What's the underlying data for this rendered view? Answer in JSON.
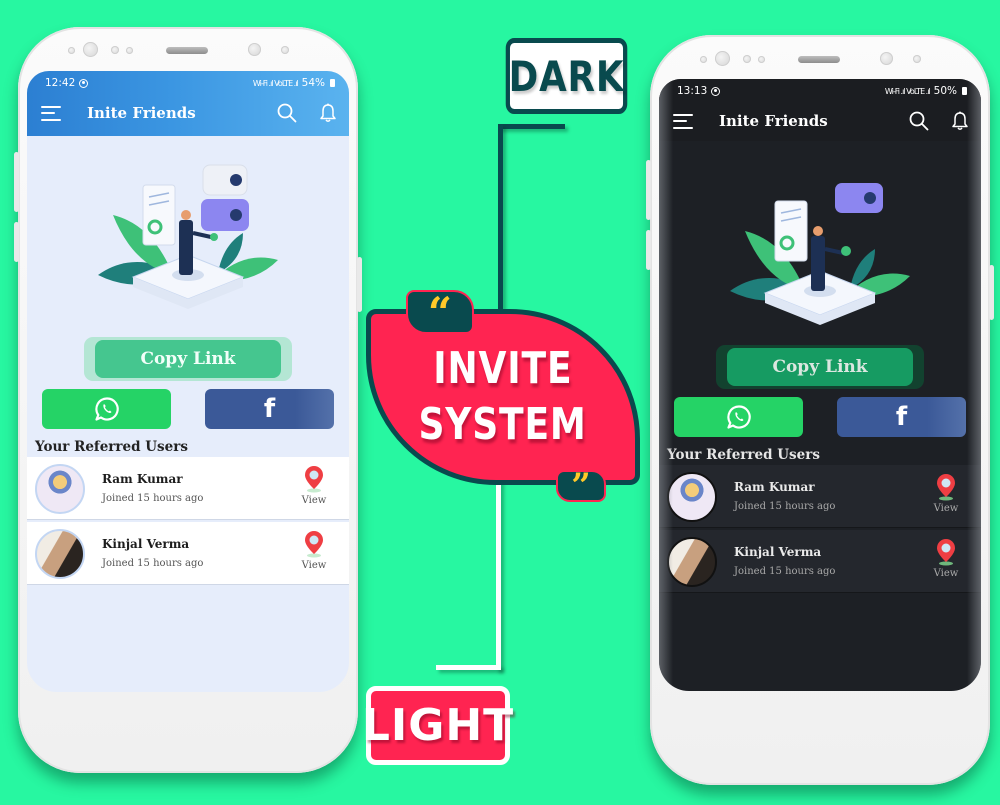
{
  "colors": {
    "background": "#27f7a1",
    "accent_teal": "#094a4e",
    "accent_red": "#ff2451",
    "quote_yellow": "#ffc929",
    "whatsapp_green": "#25d366",
    "facebook_blue": "#3b5998",
    "light_header": "#3b96e2",
    "dark_header": "#1b1d21"
  },
  "center": {
    "dark_label": "DARK",
    "light_label": "LIGHT",
    "badge_line1": "INVITE",
    "badge_line2": "SYSTEM",
    "quote_open": "“",
    "quote_close": "”"
  },
  "light_phone": {
    "theme": "light",
    "status": {
      "time": "12:42",
      "signal": "Wi-Fi .ıl VoLTE .ıl",
      "battery": "54%"
    },
    "appbar": {
      "title": "Inite Friends",
      "menu_icon": "hamburger-icon",
      "search_icon": "search-icon",
      "bell_icon": "bell-icon"
    },
    "illustration": "invite-illustration",
    "copy_link_label": "Copy Link",
    "share": {
      "whatsapp_icon": "whatsapp-icon",
      "facebook_icon": "facebook-icon",
      "facebook_glyph": "f"
    },
    "section_title": "Your Referred Users",
    "users": [
      {
        "name": "Ram Kumar",
        "subtitle": "Joined 15 hours ago",
        "action": "View",
        "action_icon": "location-pin-icon"
      },
      {
        "name": "Kinjal Verma",
        "subtitle": "Joined 15 hours ago",
        "action": "View",
        "action_icon": "location-pin-icon"
      }
    ]
  },
  "dark_phone": {
    "theme": "dark",
    "status": {
      "time": "13:13",
      "signal": "Wi-Fi .ıl VoLTE .ıl",
      "battery": "50%"
    },
    "appbar": {
      "title": "Inite Friends",
      "menu_icon": "hamburger-icon",
      "search_icon": "search-icon",
      "bell_icon": "bell-icon"
    },
    "illustration": "invite-illustration",
    "copy_link_label": "Copy Link",
    "share": {
      "whatsapp_icon": "whatsapp-icon",
      "facebook_icon": "facebook-icon",
      "facebook_glyph": "f"
    },
    "section_title": "Your Referred Users",
    "users": [
      {
        "name": "Ram Kumar",
        "subtitle": "Joined 15 hours ago",
        "action": "View",
        "action_icon": "location-pin-icon"
      },
      {
        "name": "Kinjal Verma",
        "subtitle": "Joined 15 hours ago",
        "action": "View",
        "action_icon": "location-pin-icon"
      }
    ]
  }
}
